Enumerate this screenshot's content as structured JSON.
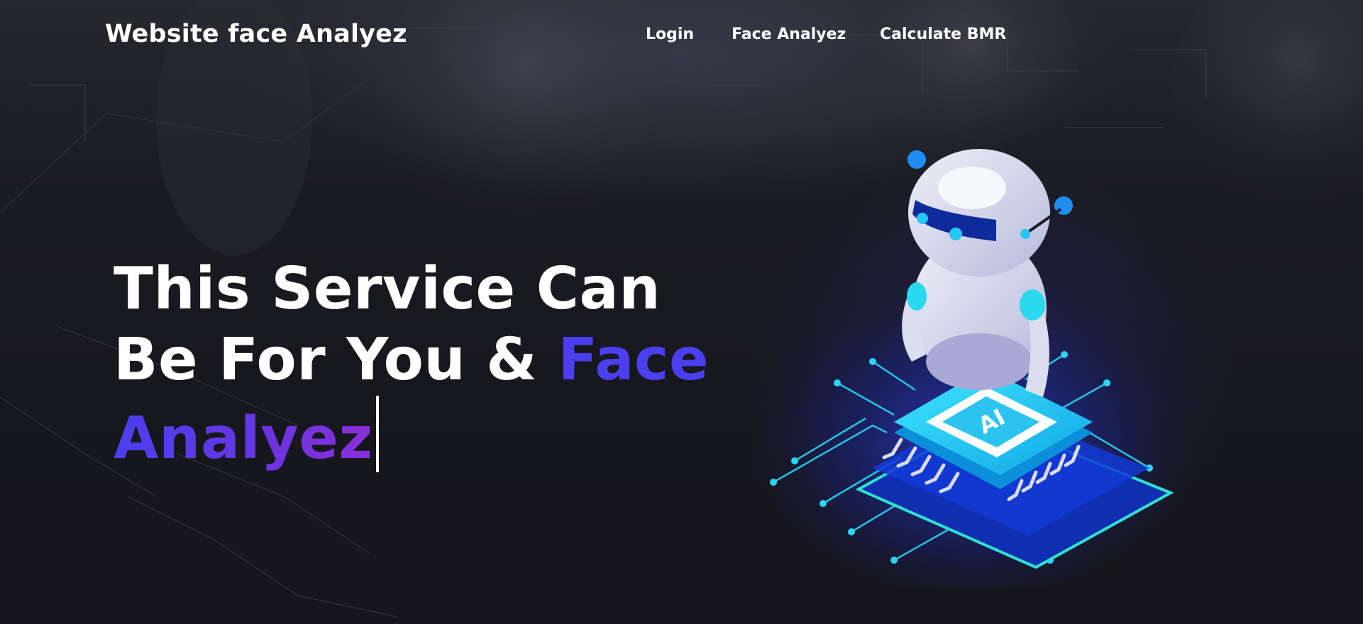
{
  "navbar": {
    "brand": "Website face Analyez",
    "links": [
      {
        "label": "Login"
      },
      {
        "label": "Face Analyez"
      },
      {
        "label": "Calculate BMR"
      }
    ]
  },
  "hero": {
    "line1": "This Service Can",
    "line2_white": "Be For You & ",
    "line2_accent": "Face",
    "line3_accent": "Analyez"
  },
  "illustration": {
    "chip_label": "AI",
    "icon": "robot-on-ai-chip-illustration"
  },
  "colors": {
    "background": "#16161d",
    "accent": "#4b3ff0",
    "accent_end": "#8a2fd8",
    "circuit": "#22d3f5",
    "text": "#ffffff"
  }
}
